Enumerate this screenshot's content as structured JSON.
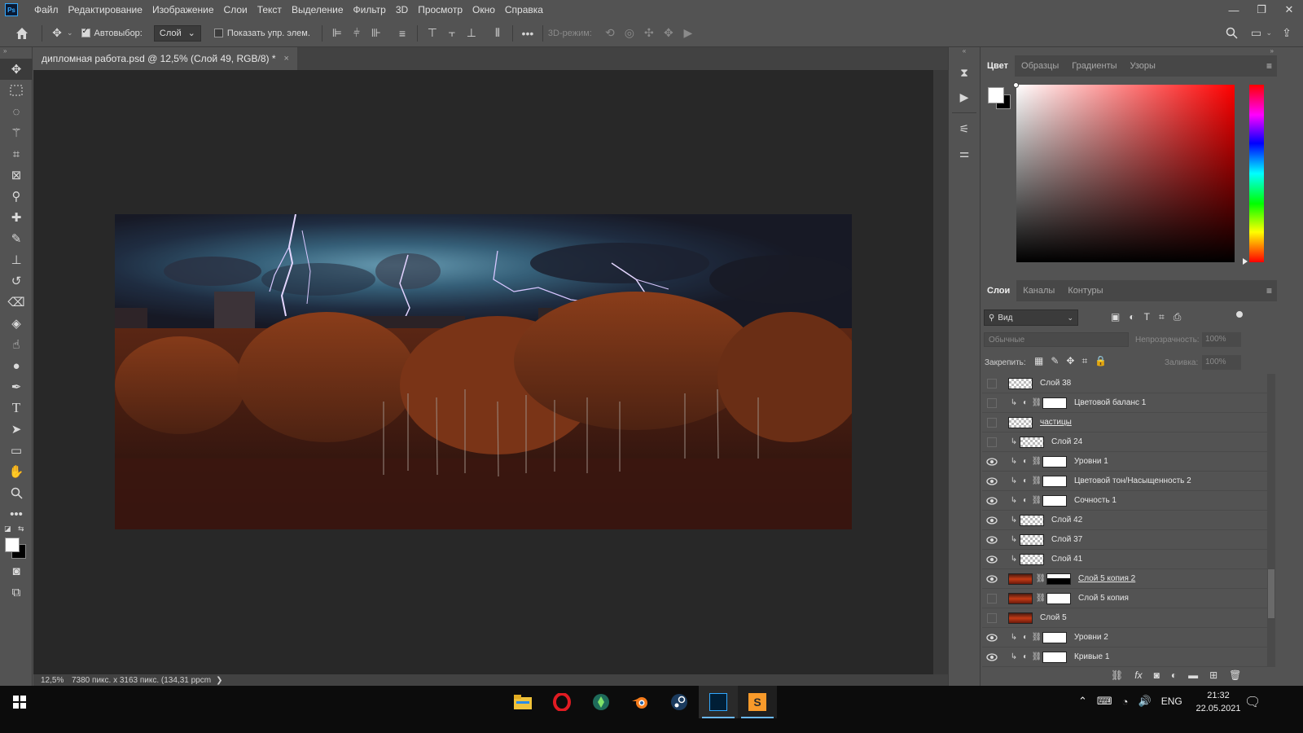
{
  "menubar": {
    "logo": "Ps",
    "items": [
      "Файл",
      "Редактирование",
      "Изображение",
      "Слои",
      "Текст",
      "Выделение",
      "Фильтр",
      "3D",
      "Просмотр",
      "Окно",
      "Справка"
    ]
  },
  "options": {
    "autoselect_label": "Автовыбор:",
    "autoselect_checked": true,
    "autoselect_value": "Слой",
    "show_controls_label": "Показать упр. элем.",
    "show_controls_checked": false,
    "mode3d_label": "3D-режим:"
  },
  "document": {
    "tab_title": "дипломная работа.psd @ 12,5% (Слой 49, RGB/8) *",
    "close": "×"
  },
  "status": {
    "zoom": "12,5%",
    "info": "7380 пикс. x 3163 пикс. (134,31 ppcm",
    "arrow": "❯"
  },
  "color_panel": {
    "tabs": [
      "Цвет",
      "Образцы",
      "Градиенты",
      "Узоры"
    ],
    "foreground": "#ffffff",
    "background": "#000000"
  },
  "layers_panel": {
    "tabs": [
      "Слои",
      "Каналы",
      "Контуры"
    ],
    "filter_label": "Вид",
    "blend_mode": "Обычные",
    "opacity_label": "Непрозрачность:",
    "opacity_value": "100%",
    "lock_label": "Закрепить:",
    "fill_label": "Заливка:",
    "fill_value": "100%",
    "layers": [
      {
        "name": "Слой 38",
        "visible": false,
        "clip": false,
        "adj": false,
        "thumb": "checker",
        "underline": false
      },
      {
        "name": "Цветовой баланс 1",
        "visible": false,
        "clip": true,
        "adj": true,
        "thumb": "white",
        "underline": false
      },
      {
        "name": "частицы",
        "visible": false,
        "clip": false,
        "adj": false,
        "thumb": "checker",
        "underline": true
      },
      {
        "name": "Слой 24",
        "visible": false,
        "clip": true,
        "adj": false,
        "thumb": "checker",
        "underline": false
      },
      {
        "name": "Уровни 1",
        "visible": true,
        "clip": true,
        "adj": true,
        "thumb": "white",
        "underline": false
      },
      {
        "name": "Цветовой тон/Насыщенность 2",
        "visible": true,
        "clip": true,
        "adj": true,
        "thumb": "white",
        "underline": false
      },
      {
        "name": "Сочность 1",
        "visible": true,
        "clip": true,
        "adj": true,
        "thumb": "white",
        "underline": false
      },
      {
        "name": "Слой 42",
        "visible": true,
        "clip": true,
        "adj": false,
        "thumb": "checker",
        "underline": false
      },
      {
        "name": "Слой 37",
        "visible": true,
        "clip": true,
        "adj": false,
        "thumb": "checker",
        "underline": false
      },
      {
        "name": "Слой 41",
        "visible": true,
        "clip": true,
        "adj": false,
        "thumb": "checker",
        "underline": false
      },
      {
        "name": "Слой 5 копия 2",
        "visible": true,
        "clip": false,
        "adj": false,
        "thumb": "photo-mask",
        "underline": true
      },
      {
        "name": "Слой 5 копия",
        "visible": false,
        "clip": false,
        "adj": false,
        "thumb": "photo-mask-white",
        "underline": false
      },
      {
        "name": "Слой 5",
        "visible": false,
        "clip": false,
        "adj": false,
        "thumb": "photo",
        "underline": false
      },
      {
        "name": "Уровни 2",
        "visible": true,
        "clip": true,
        "adj": true,
        "thumb": "white",
        "underline": false
      },
      {
        "name": "Кривые 1",
        "visible": true,
        "clip": true,
        "adj": true,
        "thumb": "white",
        "underline": false
      }
    ]
  },
  "taskbar": {
    "lang": "ENG",
    "time": "21:32",
    "date": "22.05.2021"
  },
  "colors": {
    "accent": "#31a8ff",
    "panel_bg": "#535353",
    "canvas_bg": "#282828"
  }
}
